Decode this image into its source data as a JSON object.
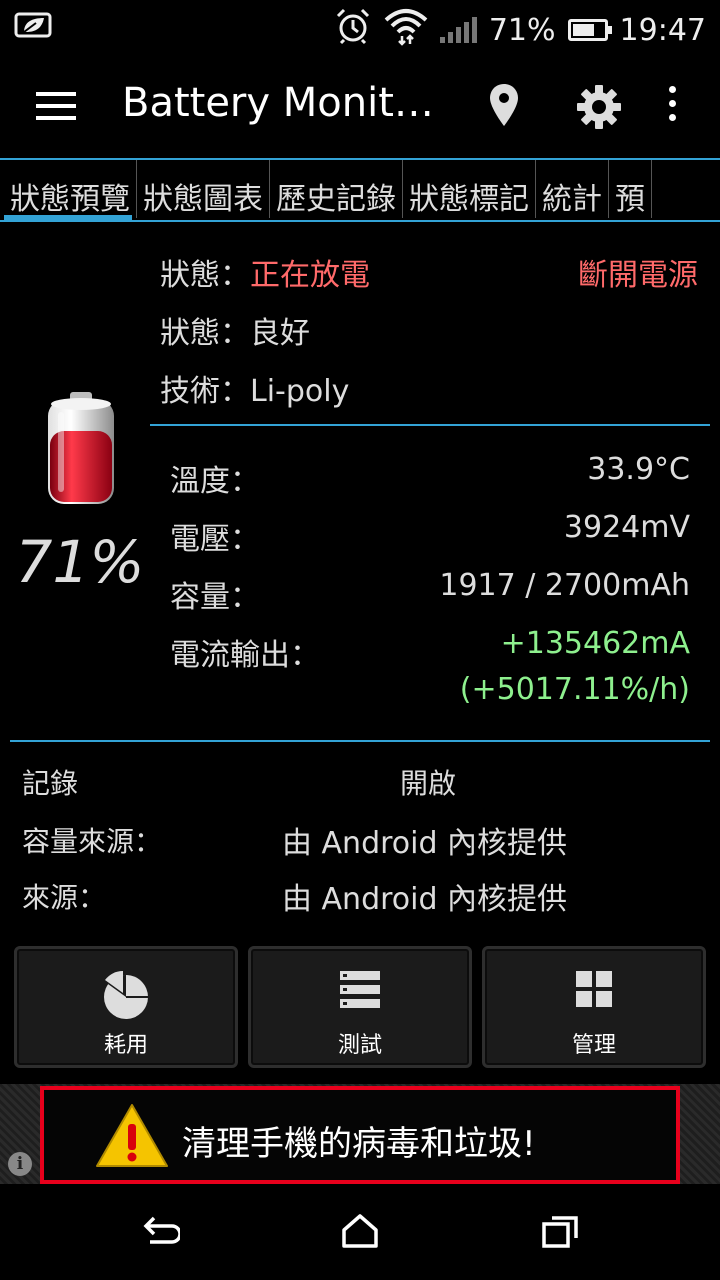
{
  "status_bar": {
    "battery_percent": "71%",
    "battery_level": 0.71,
    "time": "19:47",
    "icons": [
      "battery-saver-icon",
      "alarm-icon",
      "wifi-icon",
      "signal-icon",
      "battery-icon"
    ]
  },
  "app_bar": {
    "title": "Battery Monit…",
    "icons": [
      "menu-icon",
      "location-icon",
      "settings-icon",
      "more-icon"
    ]
  },
  "tabs": [
    {
      "label": "狀態預覽",
      "active": true
    },
    {
      "label": "狀態圖表",
      "active": false
    },
    {
      "label": "歷史記錄",
      "active": false
    },
    {
      "label": "狀態標記",
      "active": false
    },
    {
      "label": "統計",
      "active": false
    },
    {
      "label": "預",
      "active": false
    }
  ],
  "overview": {
    "battery_percent": "71%",
    "battery_level": 0.71,
    "status_label": "狀態：",
    "status_value": "正在放電",
    "power_source": "斷開電源",
    "health_label": "狀態：",
    "health_value": "良好",
    "tech_label": "技術：",
    "tech_value": "Li-poly"
  },
  "details": {
    "temp_label": "溫度：",
    "temp_value": "33.9°C",
    "voltage_label": "電壓：",
    "voltage_value": "3924mV",
    "capacity_label": "容量：",
    "capacity_value": "1917 / 2700mAh",
    "current_label": "電流輸出：",
    "current_value": "+135462mA",
    "current_rate": "(+5017.11%/h)"
  },
  "info": {
    "log_label": "記錄",
    "log_value": "開啟",
    "capacity_source_label": "容量來源：",
    "capacity_source_value": "由 Android 內核提供",
    "source_label": "來源：",
    "source_value": "由 Android 內核提供"
  },
  "buttons": [
    {
      "label": "耗用",
      "icon": "pie-chart-icon"
    },
    {
      "label": "測試",
      "icon": "list-icon"
    },
    {
      "label": "管理",
      "icon": "grid-icon"
    }
  ],
  "ad": {
    "text": "清理手機的病毒和垃圾!",
    "icon": "warning-icon",
    "info_glyph": "i"
  },
  "colors": {
    "accent": "#33a3d6",
    "discharging": "#ff6a6a",
    "current": "#8ef08e",
    "ad_border": "#e8001c"
  }
}
